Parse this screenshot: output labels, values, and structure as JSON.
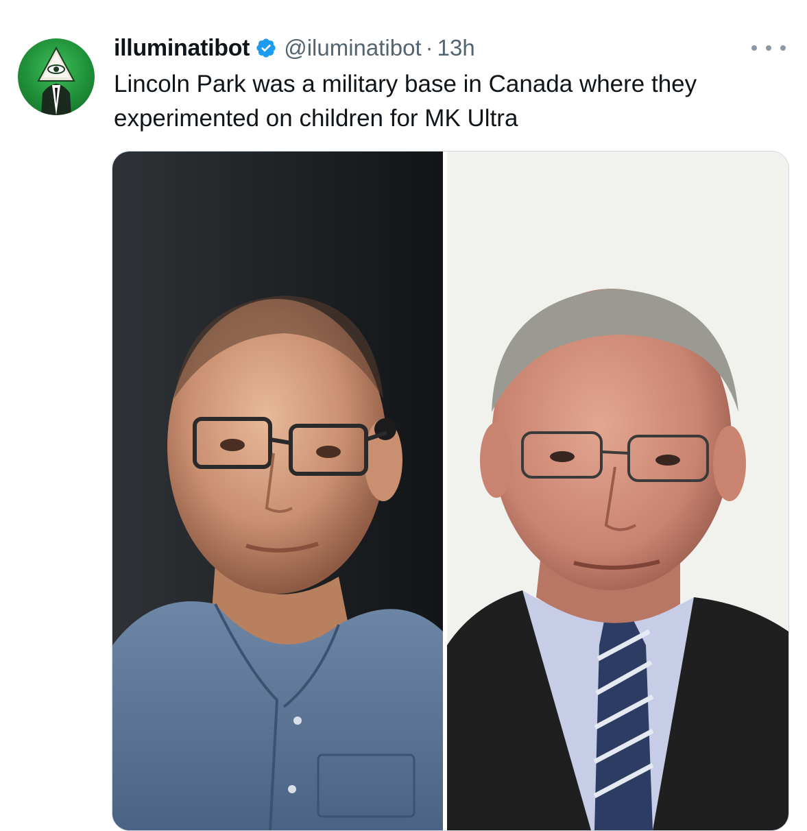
{
  "tweet": {
    "display_name": "illuminatibot",
    "handle": "@iluminatibot",
    "separator": "·",
    "timestamp": "13h",
    "text": "Lincoln Park was a military base in Canada where they experimented on children for MK Ultra",
    "verified": true
  },
  "icons": {
    "avatar": "illuminati-eye-pyramid-avatar",
    "verified": "verified-badge-icon",
    "more": "more-options-icon"
  },
  "colors": {
    "verified_badge": "#1d9bf0",
    "secondary_text": "#536471",
    "avatar_green": "#1f8f38"
  }
}
